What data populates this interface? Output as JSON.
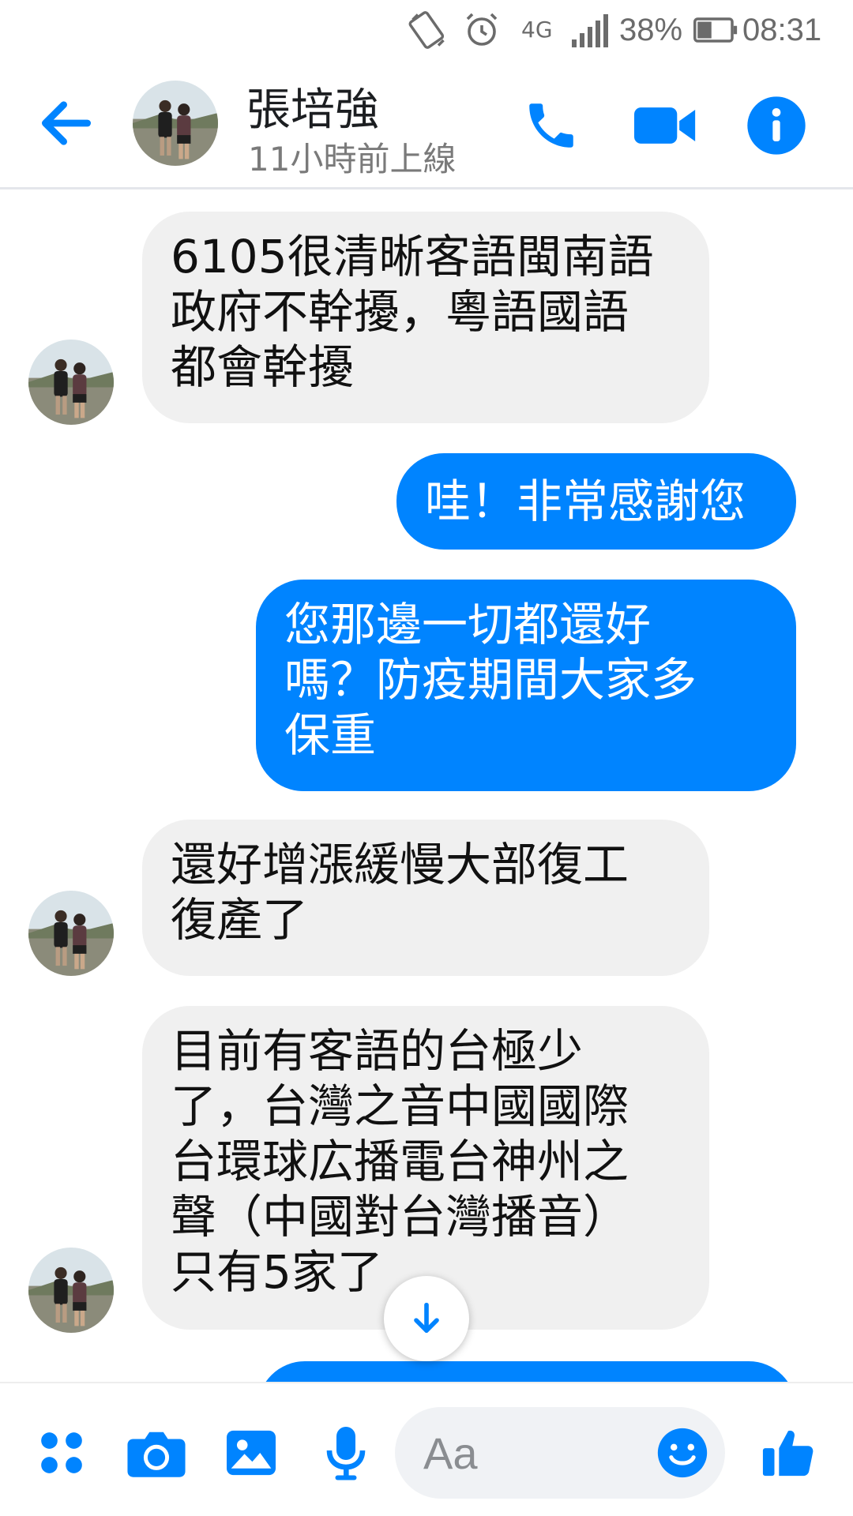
{
  "status_bar": {
    "network": "4G",
    "battery_percent": "38%",
    "time": "08:31"
  },
  "header": {
    "contact_name": "張培強",
    "last_seen": "11小時前上線",
    "icons": [
      "back-arrow-icon",
      "phone-icon",
      "video-camera-icon",
      "info-icon"
    ]
  },
  "messages": [
    {
      "from": "contact",
      "text": "6105很清晰客語閩南語\n政府不幹擾，粵語國語\n都會幹擾"
    },
    {
      "from": "me",
      "text": "哇！非常感謝您"
    },
    {
      "from": "me",
      "text": "您那邊一切都還好\n嗎？防疫期間大家多\n保重"
    },
    {
      "from": "contact",
      "text": "還好增漲緩慢大部復工\n復產了"
    },
    {
      "from": "contact",
      "text": "目前有客語的台極少\n了，台灣之音中國國際\n台環球広播電台神州之\n聲（中國對台灣播音）\n只有5家了"
    }
  ],
  "composer": {
    "placeholder": "Aa",
    "icons": [
      "apps-icon",
      "camera-icon",
      "image-icon",
      "microphone-icon",
      "emoji-icon",
      "thumbs-up-icon"
    ]
  },
  "colors": {
    "accent": "#0084ff",
    "incoming_bubble": "#f0f0f0"
  }
}
